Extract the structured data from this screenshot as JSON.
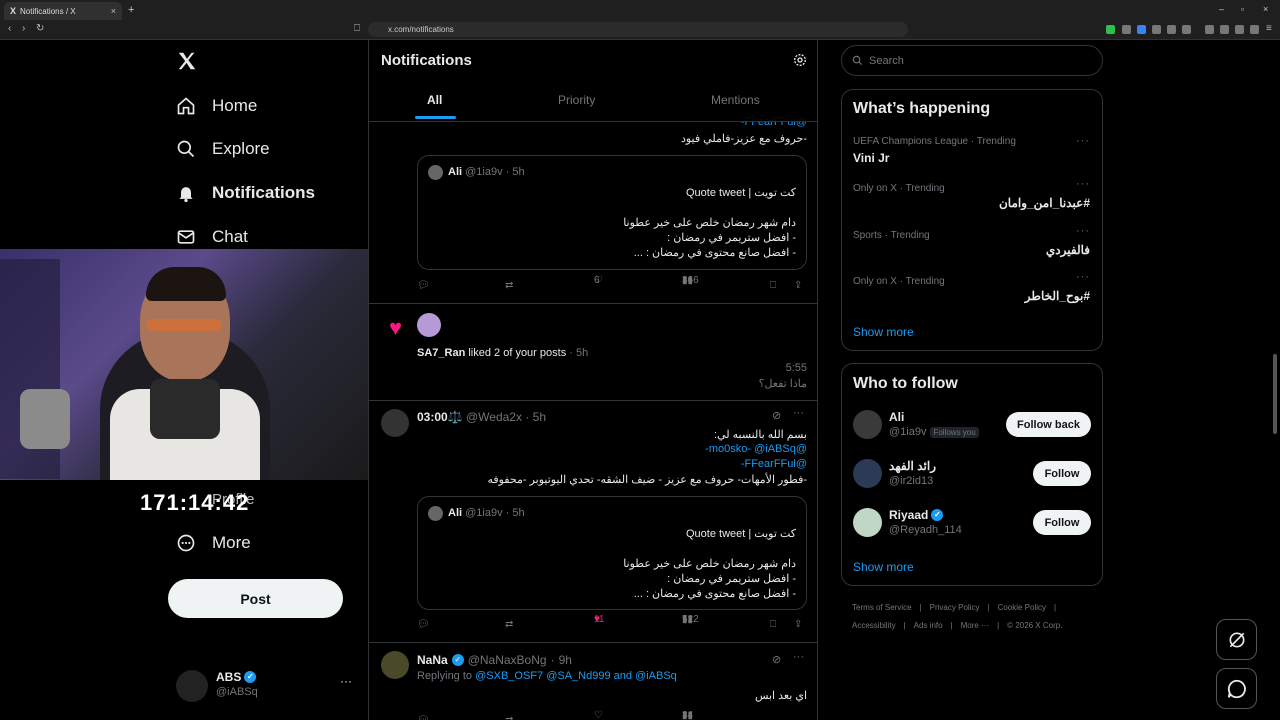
{
  "browser": {
    "tab_title": "Notifications / X",
    "url": "x.com/notifications"
  },
  "sidebar": {
    "items": [
      {
        "label": "Home",
        "icon": "home-icon"
      },
      {
        "label": "Explore",
        "icon": "search-icon"
      },
      {
        "label": "Notifications",
        "icon": "bell-icon"
      },
      {
        "label": "Chat",
        "icon": "mail-icon"
      },
      {
        "label": "More",
        "icon": "more-circle-icon"
      }
    ],
    "profile_label": "Profile",
    "post_label": "Post",
    "account": {
      "name": "ABS",
      "handle": "@iABSq"
    }
  },
  "overlay": {
    "timer": "171:14:42"
  },
  "main": {
    "title": "Notifications",
    "tabs": [
      "All",
      "Priority",
      "Mentions"
    ],
    "post1": {
      "partial_mention": "@FFearFFul-",
      "partial_text": "-حروف مع عزيز-فاملي فيود",
      "quote": {
        "name": "Ali",
        "handle": "@1ia9v",
        "time": "5h",
        "line1": "كت تويت | Quote tweet",
        "line2": "دام شهر رمضان خلص على خير عطونا",
        "line3": "- افضل ستريمر في رمضان :",
        "line4": "- افضل صانع محتوى في رمضان : ..."
      },
      "likes": "6",
      "views": "366"
    },
    "like_notification": {
      "user": "SA7_Ran",
      "text": "liked 2 of your posts",
      "time": "5h",
      "preview_time": "5:55",
      "preview_text": "ماذا تفعل؟"
    },
    "post2": {
      "name": "03:00⚖️",
      "handle": "@Weda2x",
      "time": "5h",
      "line1": "بسم الله بالنسبه لي:",
      "mentions_a": "@mo0sko- @iABSq-",
      "mentions_b": "@FFearFFul-",
      "line3": "-فطور الأمهات- حروف مع عزيز - ضيف الشقه- تحدي اليوتيوبر -محفوفه",
      "quote": {
        "name": "Ali",
        "handle": "@1ia9v",
        "time": "5h",
        "line1": "كت تويت | Quote tweet",
        "line2": "دام شهر رمضان خلص على خير عطونا",
        "line3": "- افضل ستريمر في رمضان :",
        "line4": "- افضل صانع محتوى في رمضان : ..."
      },
      "likes": "11",
      "views": "522"
    },
    "post3": {
      "name": "NaNa",
      "handle": "@NaNaxBoNg",
      "time": "9h",
      "replying_prefix": "Replying to",
      "replying_to": "@SXB_OSF7 @SA_Nd999 and @iABSq",
      "text": "اي بعد ابس",
      "views": "34"
    }
  },
  "right": {
    "search_placeholder": "Search",
    "whats_happening": {
      "title": "What’s happening",
      "trends": [
        {
          "meta": "UEFA Champions League · Trending",
          "name": "Vini Jr"
        },
        {
          "meta": "Only on X · Trending",
          "name": "#عبدنا_امن_وامان"
        },
        {
          "meta": "Sports · Trending",
          "name": "فالفيردي"
        },
        {
          "meta": "Only on X · Trending",
          "name": "#بوح_الخاطر"
        }
      ],
      "show_more": "Show more"
    },
    "who_to_follow": {
      "title": "Who to follow",
      "users": [
        {
          "name": "Ali",
          "handle": "@1ia9v",
          "badge": "Follows you",
          "button": "Follow back"
        },
        {
          "name": "رائد الفهد",
          "handle": "@ir2id13",
          "button": "Follow"
        },
        {
          "name": "Riyaad",
          "handle": "@Reyadh_114",
          "button": "Follow"
        }
      ],
      "show_more": "Show more"
    },
    "footer": {
      "line1": [
        "Terms of Service",
        "Privacy Policy",
        "Cookie Policy"
      ],
      "line2": [
        "Accessibility",
        "Ads info",
        "More ···",
        "© 2026 X Corp."
      ]
    }
  },
  "colors": {
    "accent": "#1d9bf0",
    "like": "#f91880",
    "verified": "#1d9bf0"
  }
}
